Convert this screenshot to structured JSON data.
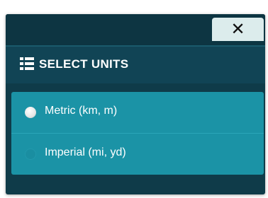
{
  "dialog": {
    "close_label": "✕",
    "title": "SELECT UNITS",
    "title_icon": "list-icon"
  },
  "options": [
    {
      "label": "Metric (km, m)",
      "selected": true
    },
    {
      "label": "Imperial (mi, yd)",
      "selected": false
    }
  ],
  "colors": {
    "panel_bg": "#0f3b49",
    "option_bg": "#1b93a6",
    "close_bg": "#dcecec"
  }
}
